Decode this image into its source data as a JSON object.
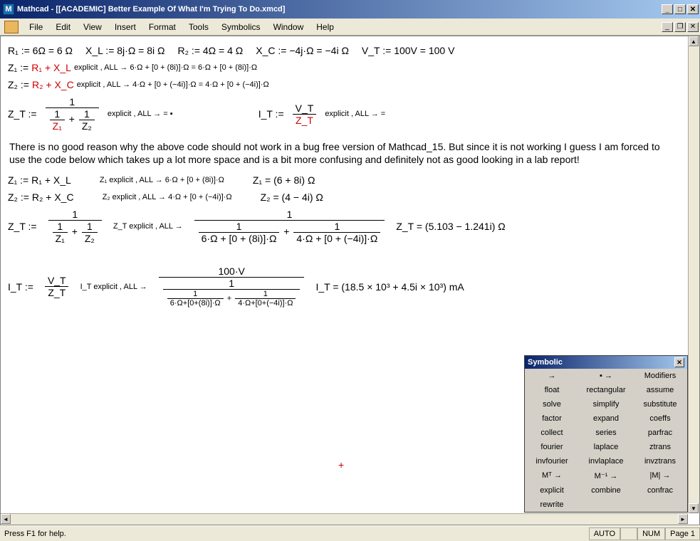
{
  "window": {
    "title": "Mathcad - [[ACADEMIC] Better Example Of What I'm Trying To Do.xmcd]",
    "app_icon": "M"
  },
  "menu": [
    "File",
    "Edit",
    "View",
    "Insert",
    "Format",
    "Tools",
    "Symbolics",
    "Window",
    "Help"
  ],
  "equations": {
    "line1": {
      "r1": "R₁ := 6Ω = 6 Ω",
      "xl": "X_L := 8j·Ω = 8i Ω",
      "r2": "R₂ := 4Ω = 4 Ω",
      "xc": "X_C := −4j·Ω = −4i Ω",
      "vt": "V_T := 100V = 100 V"
    },
    "z1": {
      "lhs": "Z₁ := ",
      "expr_red": "R₁ + X_L",
      "rhs": " explicit , ALL  →  6·Ω + [0 + (8i)]·Ω = 6·Ω + [0 + (8i)]·Ω"
    },
    "z2": {
      "lhs": "Z₂ := ",
      "expr_red": "R₂ + X_C",
      "rhs": " explicit , ALL  →  4·Ω + [0 + (−4i)]·Ω = 4·Ω + [0 + (−4i)]·Ω"
    },
    "zt": {
      "lhs": "Z_T :=",
      "top": "1",
      "d1t": "1",
      "d1b": "Z₁",
      "d2t": "1",
      "d2b": "Z₂",
      "rhs": " explicit , ALL →   =  ▪"
    },
    "it": {
      "lhs": "I_T :=",
      "top": "V_T",
      "bot": "Z_T",
      "rhs": " explicit , ALL →   ="
    },
    "note": "There is no good reason why the above code should not work in a bug free version of Mathcad_15.  But since it is not working I guess I am forced to use the code below which takes up a lot more space and is a bit more confusing and definitely not as good looking in a lab report!",
    "z1b": {
      "a": "Z₁ := R₁ + X_L",
      "b": "Z₁ explicit , ALL  →  6·Ω + [0 + (8i)]·Ω",
      "c": "Z₁ = (6 + 8i) Ω"
    },
    "z2b": {
      "a": "Z₂ := R₂ + X_C",
      "b": "Z₂ explicit , ALL  →  4·Ω + [0 + (−4i)]·Ω",
      "c": "Z₂ = (4 − 4i) Ω"
    },
    "ztb": {
      "lhs": "Z_T :=",
      "top": "1",
      "d1t": "1",
      "d1b": "Z₁",
      "d2t": "1",
      "d2b": "Z₂",
      "mid": "Z_T explicit , ALL  →",
      "big_top": "1",
      "big_d1t": "1",
      "big_d1b": "6·Ω + [0 + (8i)]·Ω",
      "big_d2t": "1",
      "big_d2b": "4·Ω + [0 + (−4i)]·Ω",
      "result": "Z_T = (5.103 − 1.241i) Ω"
    },
    "itb": {
      "lhs": "I_T :=",
      "top": "V_T",
      "bot": "Z_T",
      "mid": "I_T explicit , ALL  →",
      "big_top": "100·V",
      "big_bot_top": "1",
      "big_d1t": "1",
      "big_d1b": "6·Ω+[0+(8i)]·Ω",
      "big_d2t": "1",
      "big_d2b": "4·Ω+[0+(−4i)]·Ω",
      "result": "I_T = (18.5 × 10³ + 4.5i × 10³) mA"
    }
  },
  "symbolic": {
    "title": "Symbolic",
    "buttons": [
      "→",
      "▪ →",
      "Modifiers",
      "float",
      "rectangular",
      "assume",
      "solve",
      "simplify",
      "substitute",
      "factor",
      "expand",
      "coeffs",
      "collect",
      "series",
      "parfrac",
      "fourier",
      "laplace",
      "ztrans",
      "invfourier",
      "invlaplace",
      "invztrans",
      "Mᵀ →",
      "M⁻¹ →",
      "|M| →",
      "explicit",
      "combine",
      "confrac",
      "rewrite",
      "",
      ""
    ]
  },
  "status": {
    "help": "Press F1 for help.",
    "auto": "AUTO",
    "num": "NUM",
    "page": "Page 1"
  }
}
